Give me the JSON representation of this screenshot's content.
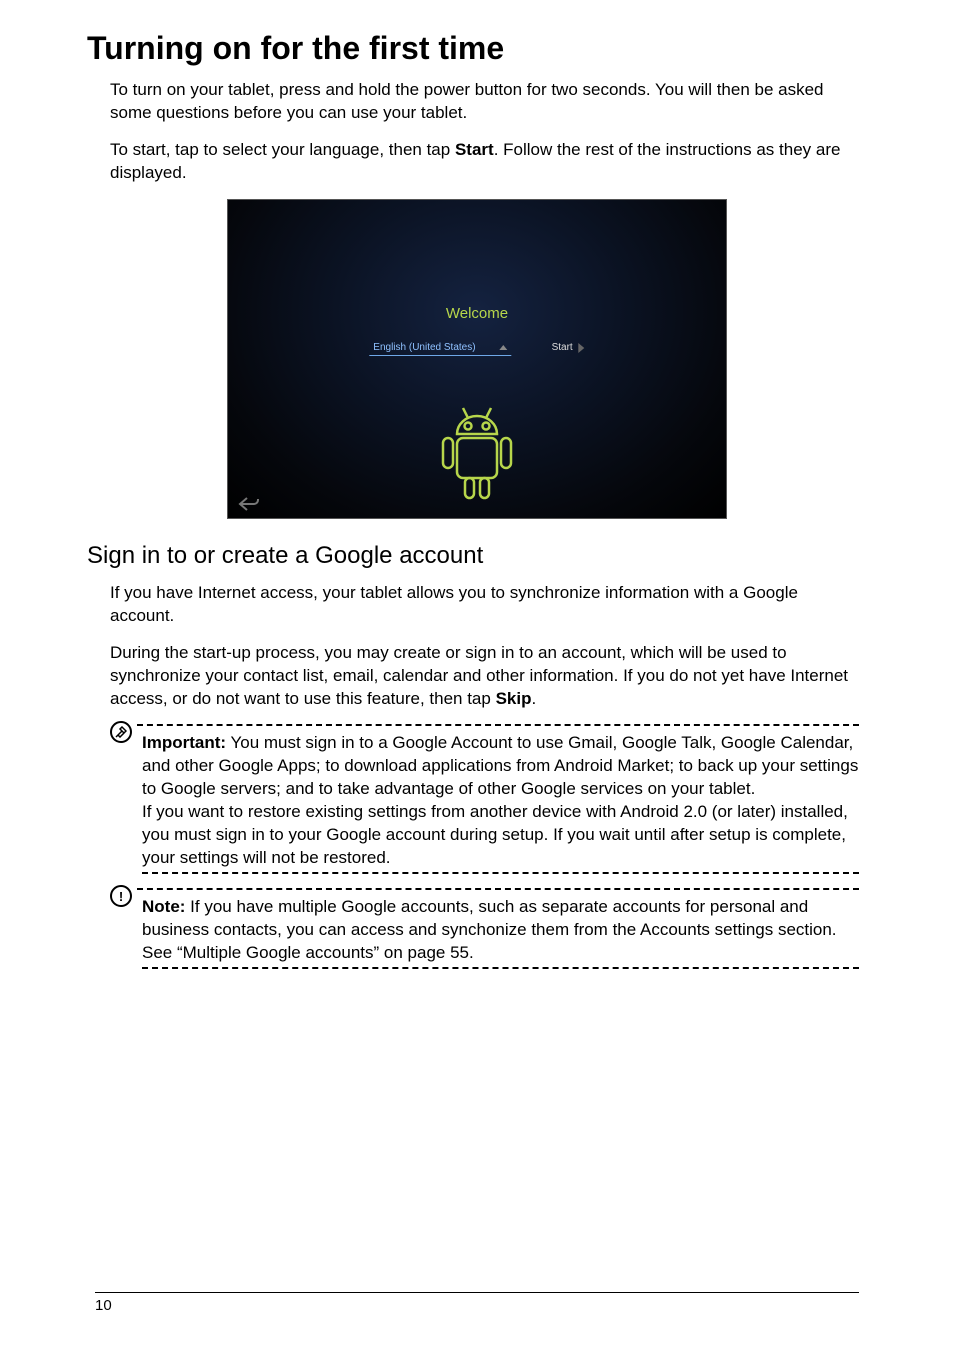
{
  "heading1": "Turning on for the first time",
  "para1": "To turn on your tablet, press and hold the power button for two seconds. You will then be asked some questions before you can use your tablet.",
  "para2_pre": "To start, tap to select your language, then tap ",
  "para2_bold": "Start",
  "para2_post": ". Follow the rest of the instructions as they are displayed.",
  "screenshot": {
    "welcome": "Welcome",
    "language": "English (United States)",
    "start": "Start"
  },
  "heading2": "Sign in to or create a Google account",
  "para3": "If you have Internet access, your tablet allows you to synchronize information with a Google account.",
  "para4_pre": "During the start-up process, you may create or sign in to an account, which will be used to synchronize your contact list, email, calendar and other information. If you do not yet have Internet access, or do not want to use this feature, then tap ",
  "para4_bold": "Skip",
  "para4_post": ".",
  "important": {
    "label": "Important:",
    "text1": " You must sign in to a Google Account to use Gmail, Google Talk, Google Calendar, and other Google Apps; to download applications from Android Market; to back up your settings to Google servers; and to take advantage of other Google services on your tablet.",
    "text2": "If you want to restore existing settings from another device with Android 2.0 (or later) installed, you must sign in to your Google account during setup. If you wait until after setup is complete, your settings will not be restored."
  },
  "note": {
    "label": "Note:",
    "text": " If you have multiple Google accounts, such as separate accounts for personal and business contacts, you can access and synchonize them from the Accounts settings section. See “Multiple Google accounts” on page 55."
  },
  "page_number": "10"
}
